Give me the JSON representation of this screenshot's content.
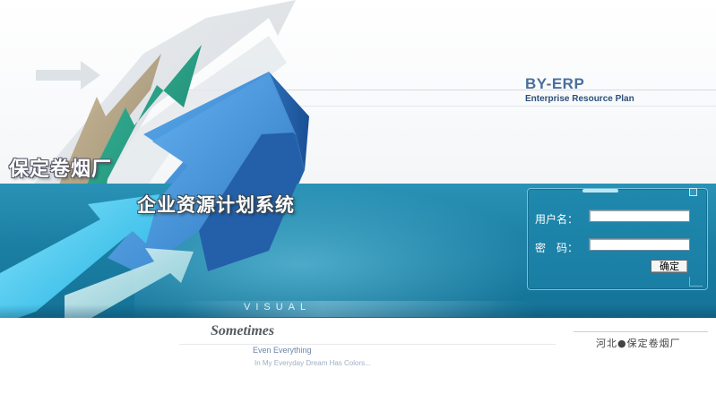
{
  "brand": {
    "name": "BY-ERP",
    "subtitle": "Enterprise Resource Plan"
  },
  "titles": {
    "factory": "保定卷烟厂",
    "system": "企业资源计划系统"
  },
  "banner": {
    "visual_label": "VISUAL"
  },
  "login": {
    "username_label": "用户名：",
    "password_label": "密　码：",
    "username_value": "",
    "password_value": "",
    "confirm_label": "确定"
  },
  "footer": {
    "sometimes": "Sometimes",
    "tagline_1": "Even Everything",
    "tagline_2": "In My Everyday Dream Has Colors...",
    "location": "河北●保定卷烟厂"
  },
  "colors": {
    "band": "#1b7fa4",
    "brand": "#4a6f9c",
    "arrow_blue": "#3a8fd8",
    "arrow_green": "#2aa58a",
    "arrow_cyan": "#34c9ee"
  }
}
